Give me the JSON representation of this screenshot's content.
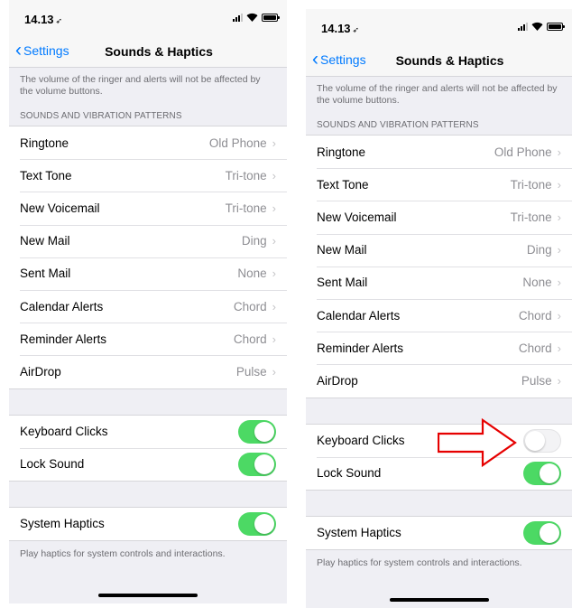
{
  "status": {
    "time": "14.13",
    "location_glyph": "➶"
  },
  "nav": {
    "back_label": "Settings",
    "title": "Sounds & Haptics"
  },
  "volume_note": "The volume of the ringer and alerts will not be affected by the volume buttons.",
  "section_header": "SOUNDS AND VIBRATION PATTERNS",
  "sounds": [
    {
      "label": "Ringtone",
      "value": "Old Phone"
    },
    {
      "label": "Text Tone",
      "value": "Tri-tone"
    },
    {
      "label": "New Voicemail",
      "value": "Tri-tone"
    },
    {
      "label": "New Mail",
      "value": "Ding"
    },
    {
      "label": "Sent Mail",
      "value": "None"
    },
    {
      "label": "Calendar Alerts",
      "value": "Chord"
    },
    {
      "label": "Reminder Alerts",
      "value": "Chord"
    },
    {
      "label": "AirDrop",
      "value": "Pulse"
    }
  ],
  "left": {
    "keyboard_clicks": true,
    "lock_sound": true,
    "system_haptics": true
  },
  "right": {
    "keyboard_clicks": false,
    "lock_sound": true,
    "system_haptics": true
  },
  "labels": {
    "keyboard_clicks": "Keyboard Clicks",
    "lock_sound": "Lock Sound",
    "system_haptics": "System Haptics"
  },
  "haptics_note": "Play haptics for system controls and interactions.",
  "colors": {
    "accent": "#007aff",
    "toggle_on": "#4cd964",
    "annotation_arrow": "#e60000"
  },
  "icons": {
    "back": "chevron-left-icon",
    "disclosure": "chevron-right-icon",
    "signal": "cellular-signal-icon",
    "wifi": "wifi-icon",
    "battery": "battery-icon"
  }
}
